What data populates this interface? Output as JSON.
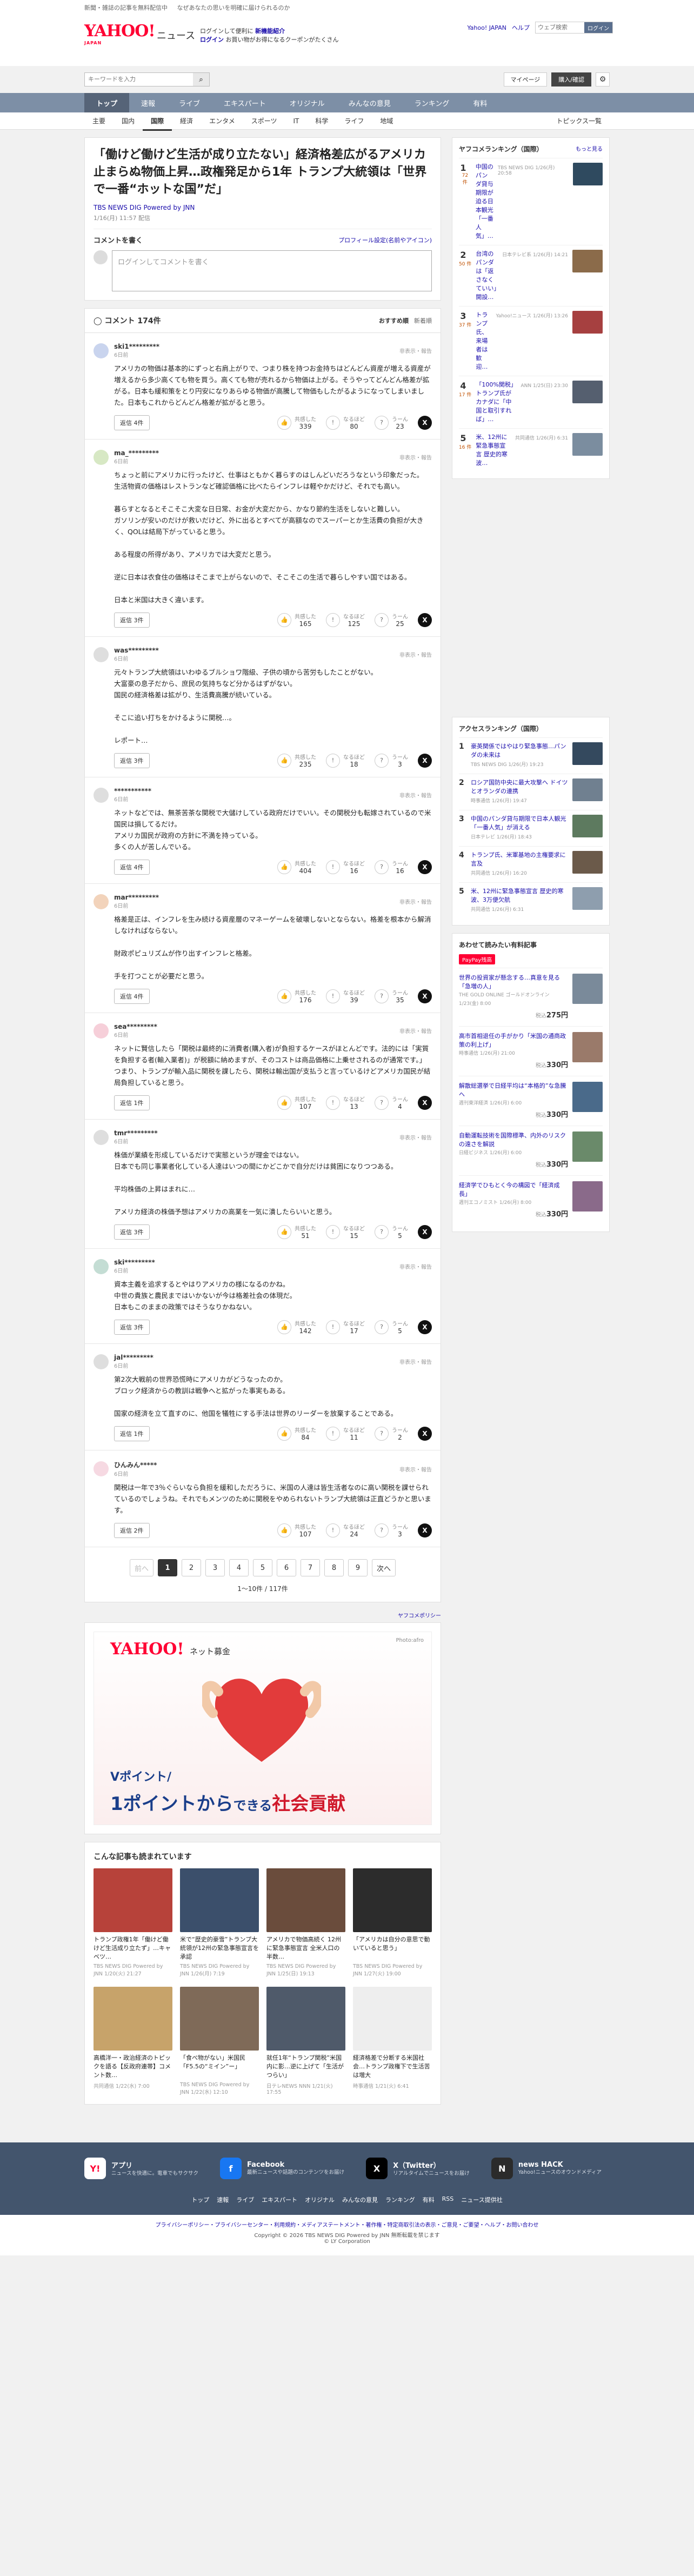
{
  "topstrip": {
    "left": "新聞・雑誌の記事を無料配信中",
    "right": "なぜあなたの思いを明確に届けられるのか"
  },
  "header": {
    "logo": "YAHOO!",
    "logo_sub": "JAPAN",
    "service": "ニュース",
    "promo1": "ログインして便利に",
    "promo_link": "新機能紹介",
    "promo2": "ログイン",
    "promo3": "お買い物がお得になるクーポンがたくさん",
    "links": [
      "Yahoo! JAPAN",
      "ヘルプ"
    ],
    "search_placeholder": "ウェブ検索",
    "search_btn": "ログイン"
  },
  "search": {
    "placeholder": "キーワードを入力",
    "mypage": "マイページ",
    "register": "購入/確認"
  },
  "gnav": [
    "トップ",
    "速報",
    "ライブ",
    "エキスパート",
    "オリジナル",
    "みんなの意見",
    "ランキング",
    "有料"
  ],
  "subnav": [
    "主要",
    "国内",
    "国際",
    "経済",
    "エンタメ",
    "スポーツ",
    "IT",
    "科学",
    "ライフ",
    "地域"
  ],
  "subnav_right": "トピックス一覧",
  "article": {
    "title": "「働けど働けど生活が成り立たない」経済格差広がるアメリカ 止まらぬ物価上昇…政権発足から1年 トランプ大統領は「世界で一番“ホットな国”だ」",
    "source": "TBS NEWS DIG Powered by JNN",
    "date": "1/16(月) 11:57 配信"
  },
  "comment_write": {
    "title": "コメントを書く",
    "link": "プロフィール設定(名前やアイコン)",
    "placeholder": "ログインしてコメントを書く"
  },
  "comments_header": {
    "title": "コメント 174件",
    "sort_a": "おすすめ順",
    "sort_b": "新着順"
  },
  "comments": [
    {
      "name": "ski1*********",
      "time": "6日前",
      "text": "アメリカの物価は基本的にずっと右肩上がりで、つまり株を持つお金持ちはどんどん資産が増える資産が増えるから多少高くても物を買う。高くても物が売れるから物価は上がる。そうやってどんどん格差が拡がる。日本も緩和策をとり円安になりあらゆる物価が高騰して物価もしたがるようになってしまいました。日本もこれからどんどん格差が拡がると思う。",
      "reply": "返信 4件",
      "r1": "339",
      "r2": "80",
      "r3": "23",
      "color": "#c9d4ee"
    },
    {
      "name": "ma_*********",
      "time": "6日前",
      "text": "ちょっと前にアメリカに行ったけど、仕事はともかく暮らすのはしんどいだろうなという印象だった。\n生活物資の価格はレストランなど確認価格に比べたらインフレは軽やかだけど、それでも高い。\n\n暮らすとなるとそこそこ大変な日日常、お金が大変だから、かなり節約生活をしないと難しい。\nガソリンが安いのだけが救いだけど、外に出るとすべてが高額なのでスーパーとか生活費の負担が大きく、QOLは結局下がっていると思う。\n\nある程度の所得があり、アメリカでは大変だと思う。\n\n逆に日本は衣食住の価格はそこまで上がらないので、そこそこの生活で暮らしやすい国ではある。\n\n日本と米国は大きく違います。",
      "reply": "返信 3件",
      "r1": "165",
      "r2": "125",
      "r3": "25",
      "color": "#d7e8c4"
    },
    {
      "name": "was*********",
      "time": "6日前",
      "text": "元々トランプ大統領はいわゆるブルショワ階級、子供の頃から苦労もしたことがない。\n大富豪の息子だから、庶民の気持ちなど分かるはずがない。\n国民の経済格差は拡がり、生活費高騰が続いている。\n\nそこに追い打ちをかけるように関税…。\n\nレポート…",
      "reply": "返信 3件",
      "r1": "235",
      "r2": "18",
      "r3": "3",
      "color": "#dedede"
    },
    {
      "name": "***********",
      "time": "6日前",
      "text": "ネットなどでは、無茶苦茶な関税で大儲けしている政府だけでいい。その関税分も転嫁されているので米国民は損してるだけ。\nアメリカ国民が政府の方針に不満を持っている。\n多くの人が苦しんでいる。",
      "reply": "返信 4件",
      "r1": "404",
      "r2": "16",
      "r3": "16",
      "color": "#dedede"
    },
    {
      "name": "mar*********",
      "time": "6日前",
      "text": "格差是正は、インフレを生み続ける資産層のマネーゲームを破壊しないとならない。格差を根本から解消しなければならない。\n\n財政ポピュリズムが作り出すインフレと格差。\n\n手を打つことが必要だと思う。",
      "reply": "返信 4件",
      "r1": "176",
      "r2": "39",
      "r3": "35",
      "color": "#f2d3bb"
    },
    {
      "name": "sea*********",
      "time": "6日前",
      "text": "ネットに賢信したら「関税は最終的に消費者(購入者)が負担するケースがほとんどです。法的には「実質を負担する者(輸入業者)」が税額に納めますが、そのコストは商品価格に上乗せされるのが通常です。」\nつまり、トランプが輸入品に関税を課したら、関税は輸出国が支払うと言っているけどアメリカ国民が結局負担していると思う。",
      "reply": "返信 1件",
      "r1": "107",
      "r2": "13",
      "r3": "4",
      "color": "#f6cfd9"
    },
    {
      "name": "tmr*********",
      "time": "6日前",
      "text": "株価が業績を形成しているだけで実態というが理金ではない。\n日本でも同じ事業者化している人達はいつの間にかどこかで自分だけは貧困になりつつある。\n\n平均株価の上昇はまれに…\n\nアメリカ経済の株価予想はアメリカの高業を一気に潰したらいいと思う。",
      "reply": "返信 3件",
      "r1": "51",
      "r2": "15",
      "r3": "5",
      "color": "#dedede"
    },
    {
      "name": "ski*********",
      "time": "6日前",
      "text": "資本主義を追求するとやはりアメリカの様になるのかね。\n中世の貴族と農民まではいかないが今は格差社会の体現だ。\n日本もこのままの政策ではそうなりかねない。",
      "reply": "返信 3件",
      "r1": "142",
      "r2": "17",
      "r3": "5",
      "color": "#c4ddd4"
    },
    {
      "name": "jal*********",
      "time": "6日前",
      "text": "第2次大戦前の世界恐慌時にアメリカがどうなったのか。\nブロック経済からの教訓は戦争へと拡がった事実もある。\n\n国家の経済を立て直すのに、他国を犠牲にする手法は世界のリーダーを放棄することである。",
      "reply": "返信 1件",
      "r1": "84",
      "r2": "11",
      "r3": "2",
      "color": "#dedede"
    },
    {
      "name": "ひんみん*****",
      "time": "6日前",
      "text": "関税は一年で3％ぐらいなら負担を緩和しただろうに、米国の人達は皆生活者なのに高い関税を課せられているのでしょうね。それでもメンツのために関税をやめられないトランプ大統領は正直どうかと思います。",
      "reply": "返信 2件",
      "r1": "107",
      "r2": "24",
      "r3": "3",
      "color": "#f6d9e2"
    }
  ],
  "reaction_labels": {
    "r1": "共感した",
    "r2": "なるほど",
    "r3": "うーん",
    "report": "非表示・報告"
  },
  "pager": {
    "prev": "前へ",
    "pages": [
      "1",
      "2",
      "3",
      "4",
      "5",
      "6",
      "7",
      "8",
      "9"
    ],
    "next": "次へ",
    "count": "1〜10件 / 117件"
  },
  "ad_label": "ヤフコメポリシー",
  "ad": {
    "logo": "YAHOO!",
    "logo_sub": "JAPAN",
    "service": "ネット募金",
    "photo": "Photo:afro",
    "line1": "Vポイント/",
    "line2a": "1ポイントから",
    "line2b": "できる",
    "line2c": "社会貢献"
  },
  "recommended": {
    "title": "こんな記事も読まれています",
    "items": [
      {
        "t": "トランプ政権1年「働けど働けど生活成り立たず」…キャベツ…",
        "s": "TBS NEWS DIG Powered by JNN 1/20(火) 21:27",
        "c": "#b7423a"
      },
      {
        "t": "米で“歴史的豪雪”トランプ大統領が12州の緊急事態宣言を承認",
        "s": "TBS NEWS DIG Powered by JNN 1/26(月) 7:19",
        "c": "#3b4f6b"
      },
      {
        "t": "アメリカで物価高続く 12州に緊急事態宣言 全米人口の半数…",
        "s": "TBS NEWS DIG Powered by JNN 1/25(日) 19:13",
        "c": "#6a4c3c"
      },
      {
        "t": "「アメリカは自分の意思で動いていると思う」",
        "s": "TBS NEWS DIG Powered by JNN 1/27(火) 19:00",
        "c": "#2c2c2c"
      },
      {
        "t": "高橋洋一・政治経済のトピックを語る【反政府連帯】コメント数…",
        "s": "共同通信 1/22(水) 7:00",
        "c": "#c7a36a"
      },
      {
        "t": "「食べ物がない」米国民「F5.5の“ミイン”ー」",
        "s": "TBS NEWS DIG Powered by JNN 1/22(水) 12:10",
        "c": "#7f6a58"
      },
      {
        "t": "就任1年“トランプ関税”米国内に影…逆に上げて「生活がつらい」",
        "s": "日テレNEWS NNN 1/21(火) 17:55",
        "c": "#4f5a6a"
      },
      {
        "t": "経済格差で分断する米国社会…トランプ政権下で生活苦は増大",
        "s": "時事通信 1/21(火) 6:41",
        "c": "#eeeeee"
      }
    ]
  },
  "side": {
    "ranking_title": "ヤフコメランキング（国際）",
    "ranking_more": "もっと見る",
    "ranking": [
      {
        "n": "1",
        "c": "72 件",
        "t": "中国のパンダ貸与期限が迫る日本観光「一番人気」…",
        "m": "TBS NEWS DIG 1/26(月) 20:58",
        "col": "#2f4a5f"
      },
      {
        "n": "2",
        "c": "50 件",
        "t": "台湾のパンダは「返さなくていい」開設…",
        "m": "日本テレビ系 1/26(月) 14:21",
        "col": "#8b6b4a"
      },
      {
        "n": "3",
        "c": "37 件",
        "t": "トランプ氏、来場者は歓迎…",
        "m": "Yahoo!ニュース 1/26(月) 13:26",
        "col": "#a64040"
      },
      {
        "n": "4",
        "c": "17 件",
        "t": "「100%関税」トランプ氏がカナダに「中国と取引すれば」…",
        "m": "ANN 1/25(日) 23:30",
        "col": "#555f6f"
      },
      {
        "n": "5",
        "c": "16 件",
        "t": "米、12州に緊急事態宣言 歴史的寒波…",
        "m": "共同通信 1/26(月) 6:31",
        "col": "#7b8d9f"
      }
    ],
    "access_title": "アクセスランキング（国際）",
    "access": [
      {
        "n": "1",
        "t": "豪英関係ではやはり緊急事態…パンダの未来は",
        "m": "TBS NEWS DIG 1/26(月) 19:23",
        "col": "#34495e"
      },
      {
        "n": "2",
        "t": "ロシア国防中央に最大攻撃へ ドイツとオランダの連携",
        "m": "時事通信 1/26(月) 19:47",
        "col": "#708090"
      },
      {
        "n": "3",
        "t": "中国のパンダ貸与期限で日本人観光「一番人気」が消える",
        "m": "日本テレビ 1/26(月) 18:43",
        "col": "#5d7a5f"
      },
      {
        "n": "4",
        "t": "トランプ氏、米軍基地の主権要求に言及",
        "m": "共同通信 1/26(月) 16:20",
        "col": "#6b5a4a"
      },
      {
        "n": "5",
        "t": "米、12州に緊急事態宣言 歴史的寒波、3万便欠航",
        "m": "共同通信 1/26(月) 6:31",
        "col": "#8e9eae"
      }
    ],
    "pr_title": "あわせて読みたい有料記事",
    "pr_badge": "PayPay残高",
    "pr": [
      {
        "t": "世界の投資家が懸念する…真意を見る「急増の人」",
        "s": "THE GOLD ONLINE ゴールドオンライン 1/23(金) 8:00",
        "p": "275円",
        "col": "#7a8a9a"
      },
      {
        "t": "高市首相退任の手がかり「米国の通商政策の利上げ」",
        "s": "時事通信 1/26(月) 21:00",
        "p": "330円",
        "col": "#9a7a6a"
      },
      {
        "t": "解散総選挙で日経平均は“本格的”な急騰へ",
        "s": "週刊東洋経済 1/26(月) 6:00",
        "p": "330円",
        "col": "#4a6a8a"
      },
      {
        "t": "自動運転技術を国際標準、内外のリスクの遠さを解説",
        "s": "日経ビジネス 1/26(月) 6:00",
        "p": "330円",
        "col": "#6a8a6a"
      },
      {
        "t": "経済学でひもとく今の構図で「経済成長」",
        "s": "週刊エコノミスト 1/26(月) 8:00",
        "p": "330円",
        "col": "#8a6a8a"
      }
    ],
    "price_prefix": "税込"
  },
  "footer": {
    "apps": [
      {
        "name": "アプリ",
        "desc": "ニュースを快適に。電車でもサクサク",
        "icon": "Y!",
        "color": "#ffffff",
        "fg": "#ff0033"
      },
      {
        "name": "Facebook",
        "desc": "最新ニュースや話題のコンテンツをお届け",
        "icon": "f",
        "color": "#1877f2",
        "fg": "#ffffff"
      },
      {
        "name": "X（Twitter）",
        "desc": "リアルタイムでニュースをお届け",
        "icon": "X",
        "color": "#000000",
        "fg": "#ffffff"
      },
      {
        "name": "news HACK",
        "desc": "Yahoo!ニュースのオウンドメディア",
        "icon": "N",
        "color": "#2b2b2b",
        "fg": "#ffffff"
      }
    ],
    "links": [
      "トップ",
      "速報",
      "ライブ",
      "エキスパート",
      "オリジナル",
      "みんなの意見",
      "ランキング",
      "有料",
      "RSS",
      "ニュース提供社"
    ],
    "policy": "プライバシーポリシー・プライバシーセンター・利用規約・メディアステートメント・著作権・特定商取引法の表示・ご意見・ご要望・ヘルプ・お問い合わせ",
    "copyright": "Copyright © 2026 TBS NEWS DIG Powered by JNN 無断転載を禁じます",
    "lycorp": "© LY Corporation"
  }
}
